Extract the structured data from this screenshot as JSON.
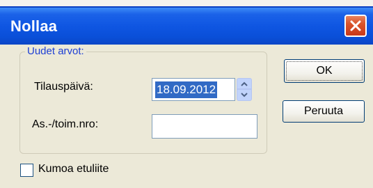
{
  "dialog": {
    "title": "Nollaa",
    "close_icon": "close-icon"
  },
  "group": {
    "legend": "Uudet arvot:",
    "order_date_label": "Tilauspäivä:",
    "order_date_value": "18.09.2012",
    "customer_number_label": "As.-/toim.nro:",
    "customer_number_value": ""
  },
  "buttons": {
    "ok": "OK",
    "cancel": "Peruuta"
  },
  "checkbox": {
    "label": "Kumoa etuliite",
    "checked": false
  },
  "colors": {
    "titlebar": "#0a4fd8",
    "close_button": "#d9542b",
    "dialog_background": "#ece9d8",
    "group_legend": "#1e3fd4",
    "selection": "#316ac5"
  }
}
